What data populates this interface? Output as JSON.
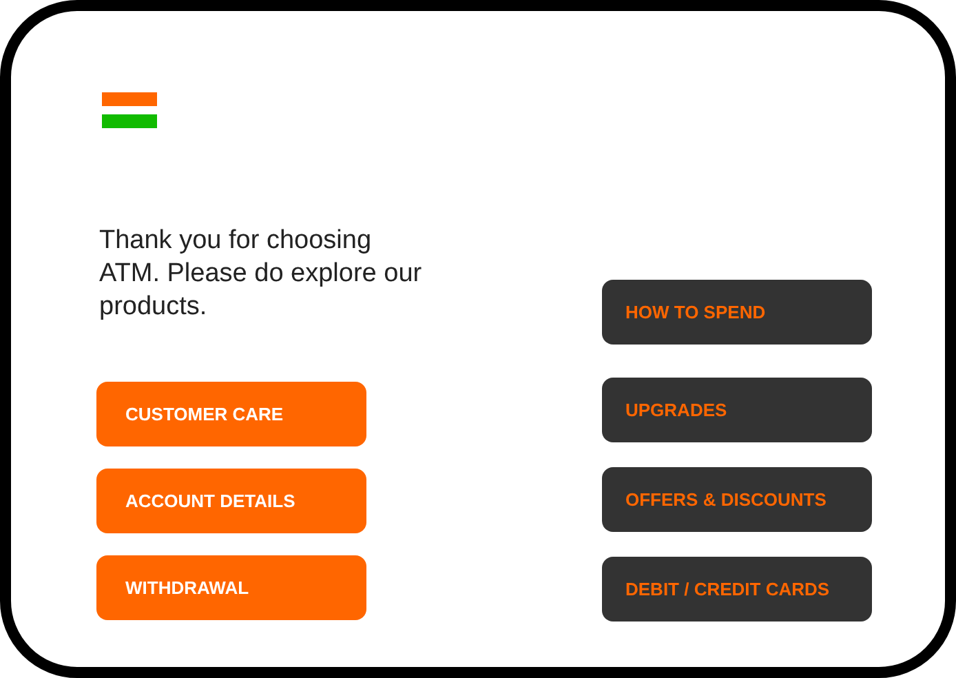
{
  "message": "Thank you for choosing ATM. Please do explore our products.",
  "left_buttons": [
    {
      "label": "CUSTOMER CARE",
      "kind": "primary"
    },
    {
      "label": "ACCOUNT DETAILS",
      "kind": "primary"
    },
    {
      "label": "WITHDRAWAL",
      "kind": "primary"
    }
  ],
  "right_buttons": [
    {
      "label": "HOW TO SPEND",
      "kind": "secondary"
    },
    {
      "label": "UPGRADES",
      "kind": "secondary"
    },
    {
      "label": "OFFERS & DISCOUNTS",
      "kind": "secondary"
    },
    {
      "label": "DEBIT / CREDIT CARDS",
      "kind": "secondary"
    }
  ]
}
